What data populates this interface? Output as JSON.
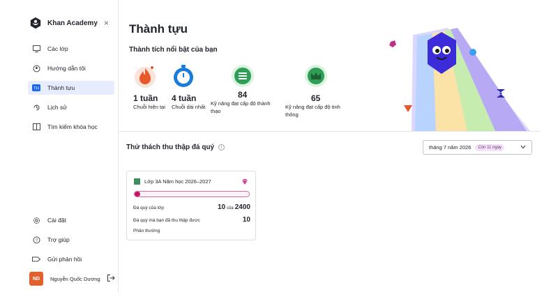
{
  "sidebar": {
    "brand": "Khan Academy",
    "close": "×",
    "items": [
      {
        "label": "Các lớp",
        "icon": "classroom-icon"
      },
      {
        "label": "Hướng dẫn tôi",
        "icon": "mentor-icon"
      },
      {
        "label": "Thành tựu",
        "icon": "trophy-icon",
        "active": true
      },
      {
        "label": "Lịch sử",
        "icon": "history-icon"
      },
      {
        "label": "Tìm kiếm khóa học",
        "icon": "course-search-icon"
      }
    ],
    "bottom_items": [
      {
        "label": "Cài đặt",
        "icon": "gear-icon"
      },
      {
        "label": "Trợ giúp",
        "icon": "help-icon"
      },
      {
        "label": "Gửi phản hồi",
        "icon": "feedback-icon"
      }
    ],
    "user": {
      "initials": "ND",
      "name": "Nguyễn Quốc Dương"
    }
  },
  "main": {
    "title": "Thành tựu",
    "highlights_title": "Thành tích nổi bật của bạn",
    "stats": [
      {
        "value": "1 tuần",
        "label": "Chuỗi hiện tại",
        "icon": "flame-icon"
      },
      {
        "value": "4 tuần",
        "label": "Chuỗi dài nhất",
        "icon": "stopwatch-icon"
      },
      {
        "value": "84",
        "label": "Kỹ năng đạt cấp độ thành thạo",
        "icon": "mastery-icon"
      },
      {
        "value": "65",
        "label": "Kỹ năng đạt cấp độ tinh thông",
        "icon": "crown-icon"
      }
    ],
    "challenge": {
      "title": "Thử thách thu thập đá quý",
      "month": "tháng 7 năm 2026",
      "days_left": "Còn 11 ngày",
      "card": {
        "class_name": "Lớp 3A Năm học 2026–2027",
        "progress_fraction": 0.004,
        "class_gems_label": "Đá quý của lớp",
        "class_gems_value": "10",
        "of_word": "của",
        "class_gems_total": "2400",
        "my_gems_label": "Đá quý mà bạn đã thu thập được",
        "my_gems_value": "10",
        "reward_label": "Phần thưởng"
      }
    }
  },
  "colors": {
    "accent": "#1865f2",
    "active_bg": "#e8ecff",
    "progress": "#c2185b",
    "hero_blob": "#3b2bd9"
  }
}
